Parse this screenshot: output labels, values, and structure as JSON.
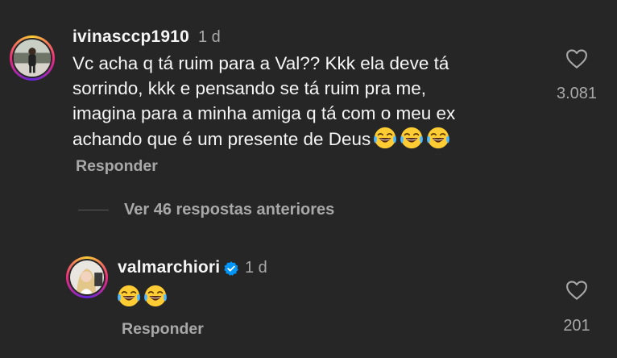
{
  "comments": [
    {
      "username": "ivinasccp1910",
      "time": "1 d",
      "text": "Vc acha q tá ruim para a Val?? Kkk ela deve tá\nsorrindo, kkk e pensando se tá ruim pra me,\nimagina para a minha amiga q tá com o meu ex\nachando que é um presente de Deus",
      "emoji": [
        "face-with-tears-of-joy",
        "face-with-tears-of-joy",
        "face-with-tears-of-joy"
      ],
      "likes": "3.081",
      "reply_label": "Responder"
    },
    {
      "username": "valmarchiori",
      "verified": true,
      "time": "1 d",
      "emoji": [
        "face-with-tears-of-joy",
        "face-with-tears-of-joy"
      ],
      "likes": "201",
      "reply_label": "Responder"
    }
  ],
  "view_replies_label": "Ver 46 respostas anteriores",
  "colors": {
    "background": "#262626",
    "primary_text": "#f5f5f5",
    "secondary_text": "#a8a8a8",
    "verified_blue": "#0095f6"
  },
  "icons": [
    "heart-outline-icon",
    "verified-badge-icon"
  ]
}
